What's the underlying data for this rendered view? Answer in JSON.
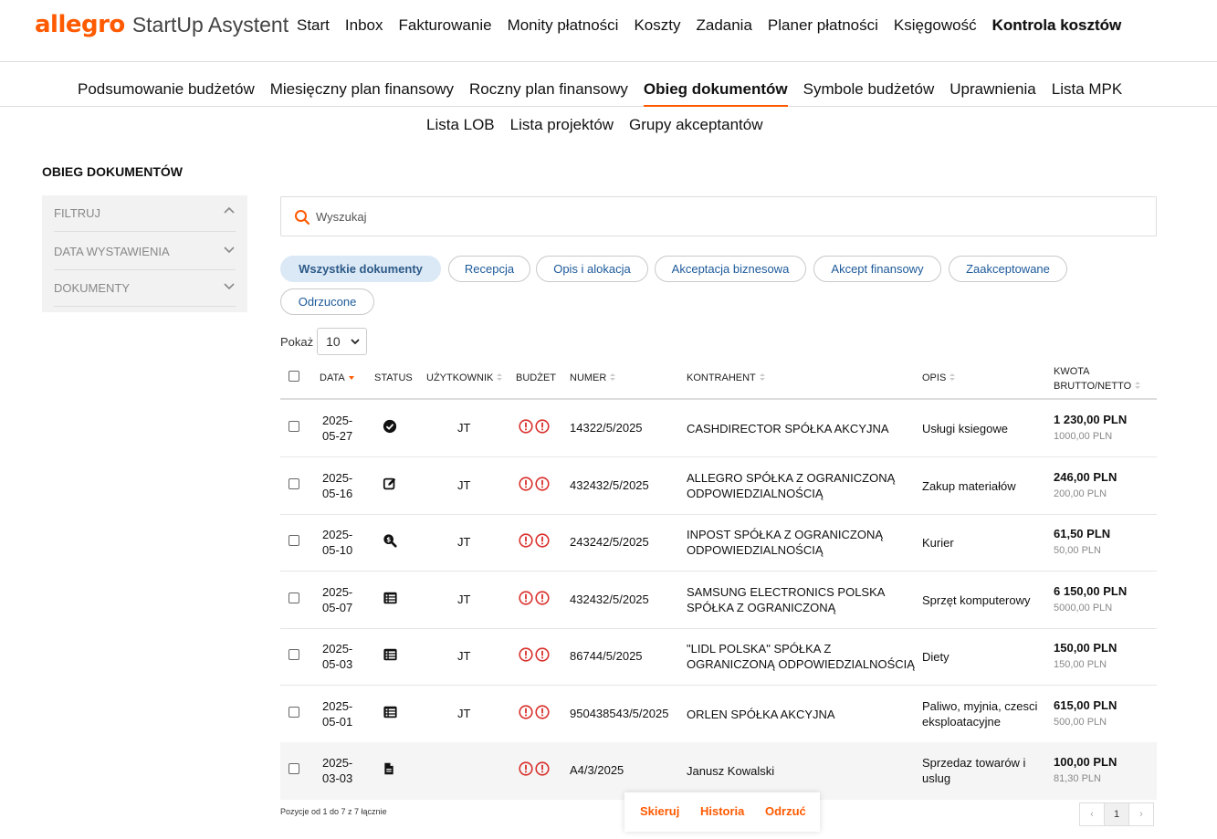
{
  "header": {
    "brand": "allegro",
    "product": "StartUp Asystent",
    "nav": [
      "Start",
      "Inbox",
      "Fakturowanie",
      "Monity płatności",
      "Koszty",
      "Zadania",
      "Planer płatności",
      "Księgowość",
      "Kontrola kosztów"
    ],
    "active_nav": "Kontrola kosztów"
  },
  "subnav": {
    "row1": [
      "Podsumowanie budżetów",
      "Miesięczny plan finansowy",
      "Roczny plan finansowy",
      "Obieg dokumentów",
      "Symbole budżetów",
      "Uprawnienia",
      "Lista MPK"
    ],
    "row2": [
      "Lista LOB",
      "Lista projektów",
      "Grupy akceptantów"
    ],
    "active": "Obieg dokumentów"
  },
  "page": {
    "title": "OBIEG DOKUMENTÓW"
  },
  "filters": {
    "header": "FILTRUJ",
    "items": [
      "DATA WYSTAWIENIA",
      "DOKUMENTY"
    ]
  },
  "search": {
    "placeholder": "Wyszukaj"
  },
  "chips": [
    "Wszystkie dokumenty",
    "Recepcja",
    "Opis i alokacja",
    "Akceptacja biznesowa",
    "Akcept finansowy",
    "Zaakceptowane",
    "Odrzucone"
  ],
  "active_chip": "Wszystkie dokumenty",
  "show": {
    "label": "Pokaż",
    "value": "10"
  },
  "table": {
    "columns": {
      "date": "DATA",
      "status": "STATUS",
      "user": "UŻYTKOWNIK",
      "budget": "BUDŻET",
      "number": "NUMER",
      "contractor": "KONTRAHENT",
      "description": "OPIS",
      "amount_1": "KWOTA",
      "amount_2": "BRUTTO/NETTO"
    },
    "rows": [
      {
        "date1": "2025-",
        "date2": "05-27",
        "status_icon": "check-circle-icon",
        "user": "JT",
        "number": "14322/5/2025",
        "contractor": "CASHDIRECTOR SPÓŁKA AKCYJNA",
        "description": "Usługi ksiegowe",
        "gross": "1 230,00 PLN",
        "net": "1000,00 PLN"
      },
      {
        "date1": "2025-",
        "date2": "05-16",
        "status_icon": "edit-icon",
        "user": "JT",
        "number": "432432/5/2025",
        "contractor": "ALLEGRO SPÓŁKA Z OGRANICZONĄ ODPOWIEDZIALNOŚCIĄ",
        "description": "Zakup materiałów",
        "gross": "246,00 PLN",
        "net": "200,00 PLN"
      },
      {
        "date1": "2025-",
        "date2": "05-10",
        "status_icon": "search-dollar-icon",
        "user": "JT",
        "number": "243242/5/2025",
        "contractor": "INPOST SPÓŁKA Z OGRANICZONĄ ODPOWIEDZIALNOŚCIĄ",
        "description": "Kurier",
        "gross": "61,50 PLN",
        "net": "50,00 PLN"
      },
      {
        "date1": "2025-",
        "date2": "05-07",
        "status_icon": "list-icon",
        "user": "JT",
        "number": "432432/5/2025",
        "contractor": "SAMSUNG ELECTRONICS POLSKA SPÓŁKA Z OGRANICZONĄ",
        "description": "Sprzęt komputerowy",
        "gross": "6 150,00 PLN",
        "net": "5000,00 PLN"
      },
      {
        "date1": "2025-",
        "date2": "05-03",
        "status_icon": "list-icon",
        "user": "JT",
        "number": "86744/5/2025",
        "contractor": "\"LIDL POLSKA\" SPÓŁKA Z OGRANICZONĄ ODPOWIEDZIALNOŚCIĄ",
        "description": "Diety",
        "gross": "150,00 PLN",
        "net": "150,00 PLN"
      },
      {
        "date1": "2025-",
        "date2": "05-01",
        "status_icon": "list-icon",
        "user": "JT",
        "number": "950438543/5/2025",
        "contractor": "ORLEN SPÓŁKA AKCYJNA",
        "description": "Paliwo, myjnia, czesci eksploatacyjne",
        "gross": "615,00 PLN",
        "net": "500,00 PLN"
      },
      {
        "date1": "2025-",
        "date2": "03-03",
        "status_icon": "document-icon",
        "user": "",
        "number": "A4/3/2025",
        "contractor": "Janusz Kowalski",
        "description": "Sprzedaz towarów i uslug",
        "gross": "100,00 PLN",
        "net": "81,30 PLN"
      }
    ]
  },
  "footer": {
    "info": "Pozycje od 1 do 7 z 7 łącznie",
    "page": "1"
  },
  "actions": [
    "Skieruj",
    "Historia",
    "Odrzuć"
  ],
  "colors": {
    "accent": "#ff5a00",
    "chip_text": "#1d5a9a",
    "chip_active_bg": "#dbe8f5",
    "warning": "#d9302c"
  }
}
